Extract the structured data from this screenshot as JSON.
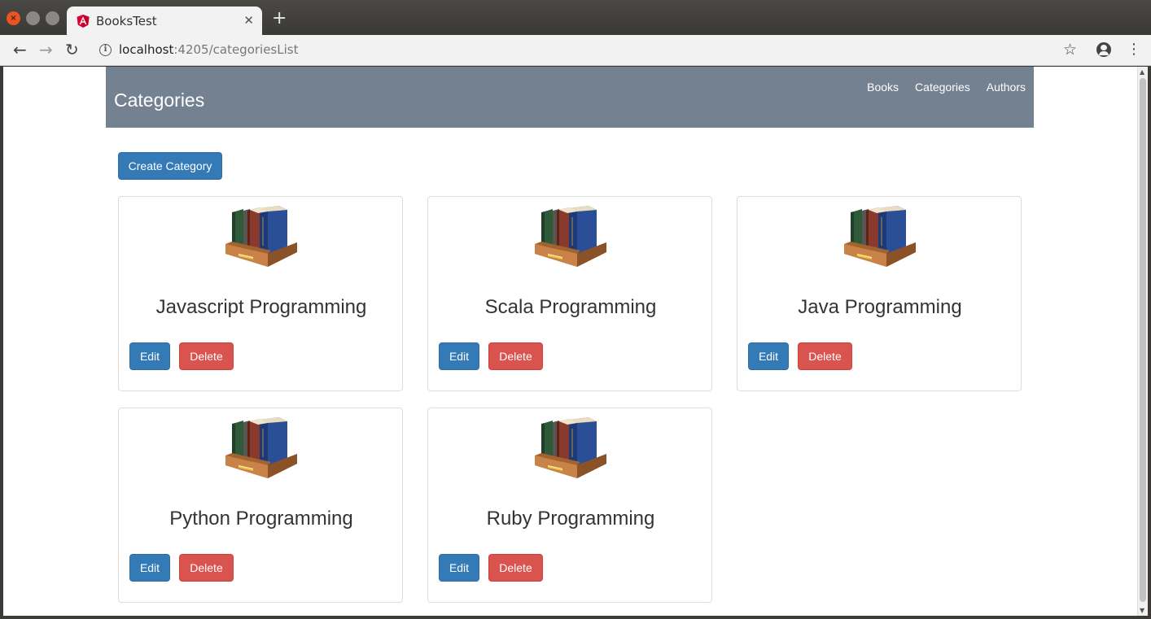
{
  "browser": {
    "tab_title": "BooksTest",
    "tab_close": "✕",
    "new_tab": "+",
    "url_host": "localhost",
    "url_rest": ":4205/categoriesList"
  },
  "header": {
    "title": "Categories",
    "nav": [
      "Books",
      "Categories",
      "Authors"
    ]
  },
  "create_button": "Create Category",
  "categories": [
    {
      "name": "Javascript Programming",
      "edit": "Edit",
      "delete": "Delete"
    },
    {
      "name": "Scala Programming",
      "edit": "Edit",
      "delete": "Delete"
    },
    {
      "name": "Java Programming",
      "edit": "Edit",
      "delete": "Delete"
    },
    {
      "name": "Python Programming",
      "edit": "Edit",
      "delete": "Delete"
    },
    {
      "name": "Ruby Programming",
      "edit": "Edit",
      "delete": "Delete"
    }
  ],
  "icons": {
    "card_image": "bookshelf-icon",
    "favicon": "angular-icon"
  },
  "colors": {
    "header_bg": "#738190",
    "primary": "#337ab7",
    "danger": "#d9534f"
  }
}
